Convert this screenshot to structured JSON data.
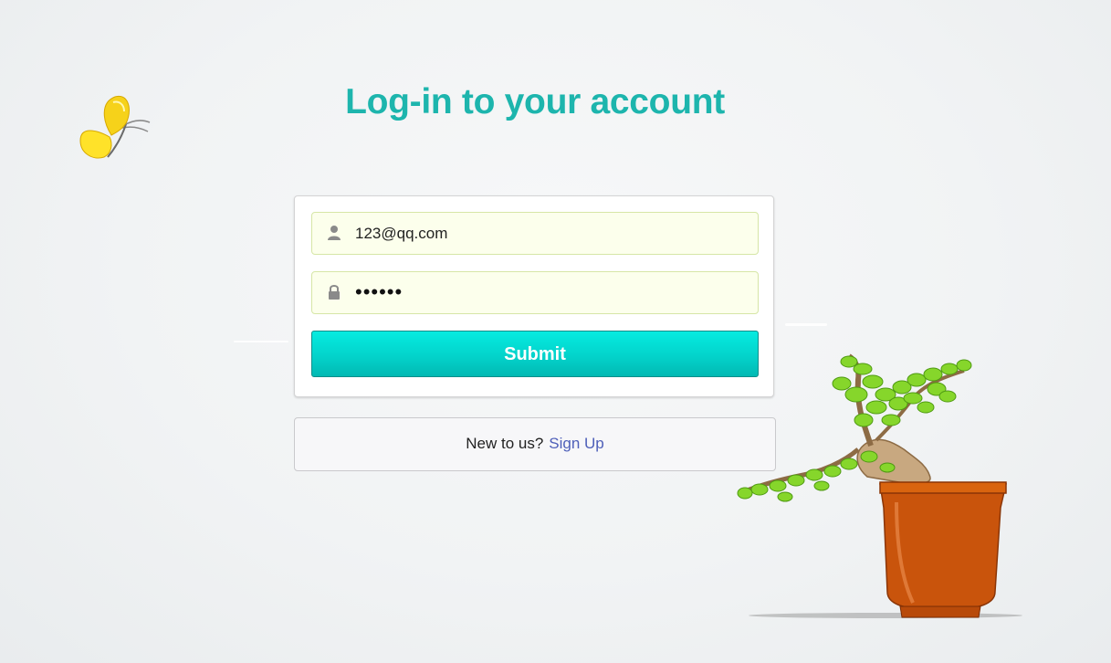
{
  "page": {
    "title": "Log-in to your account"
  },
  "form": {
    "email_value": "123@qq.com",
    "password_value": "••••••",
    "email_icon": "user-icon",
    "password_icon": "lock-icon",
    "submit_label": "Submit"
  },
  "message": {
    "prompt": "New to us?",
    "signup_label": "Sign Up"
  },
  "decorations": {
    "left": "butterfly-illustration",
    "right": "bonsai-illustration"
  },
  "colors": {
    "title": "#1db5ad",
    "submit_top": "#06ebe0",
    "submit_bottom": "#02b9b3",
    "field_background": "#fcffec",
    "link": "#4e5fb9",
    "pot": "#c9540c",
    "leaves": "#7ed321"
  }
}
